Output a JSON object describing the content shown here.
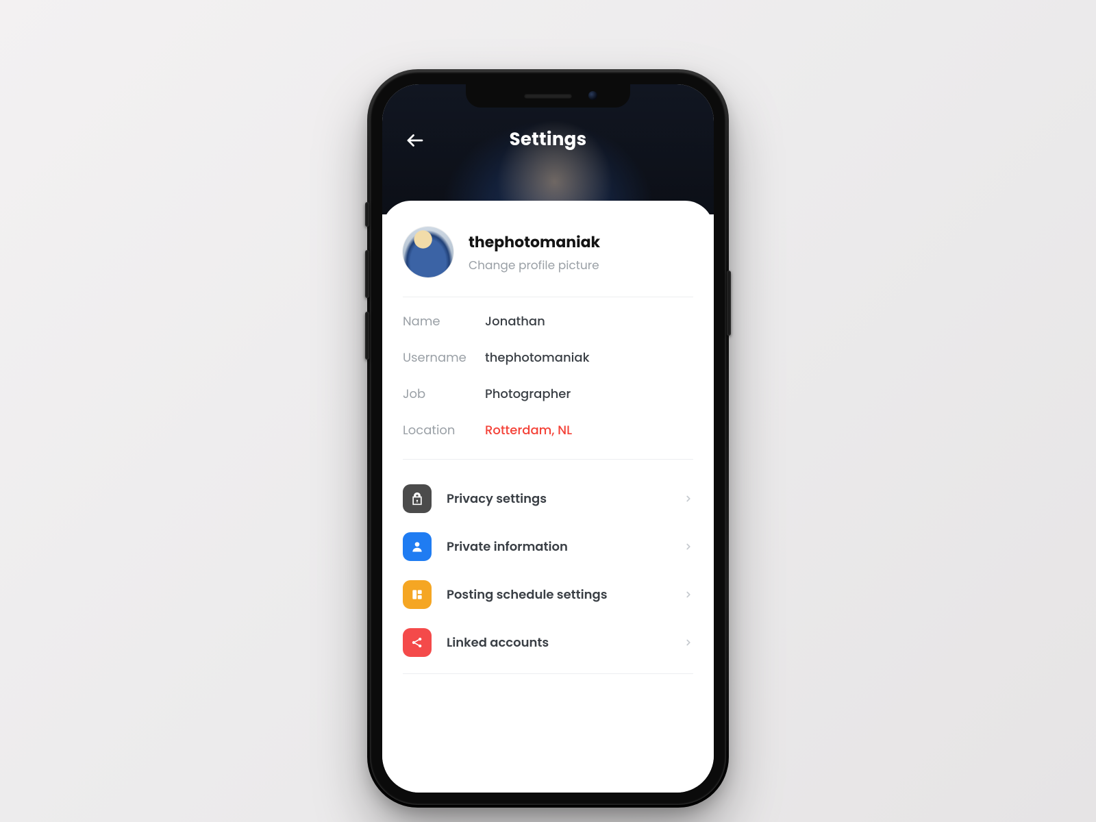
{
  "header": {
    "title": "Settings",
    "back_label": "Back"
  },
  "profile": {
    "username_display": "thephotomaniak",
    "change_photo_label": "Change profile picture"
  },
  "fields": {
    "name": {
      "label": "Name",
      "value": "Jonathan"
    },
    "username": {
      "label": "Username",
      "value": "thephotomaniak"
    },
    "job": {
      "label": "Job",
      "value": "Photographer"
    },
    "location": {
      "label": "Location",
      "value": "Rotterdam, NL"
    }
  },
  "menu": [
    {
      "id": "privacy",
      "label": "Privacy settings",
      "icon": "lock-icon",
      "color": "#4b4b4b"
    },
    {
      "id": "private",
      "label": "Private information",
      "icon": "person-icon",
      "color": "#1f7cf2"
    },
    {
      "id": "schedule",
      "label": "Posting schedule settings",
      "icon": "schedule-icon",
      "color": "#f5a623"
    },
    {
      "id": "linked",
      "label": "Linked accounts",
      "icon": "share-icon",
      "color": "#f44a4a"
    }
  ]
}
